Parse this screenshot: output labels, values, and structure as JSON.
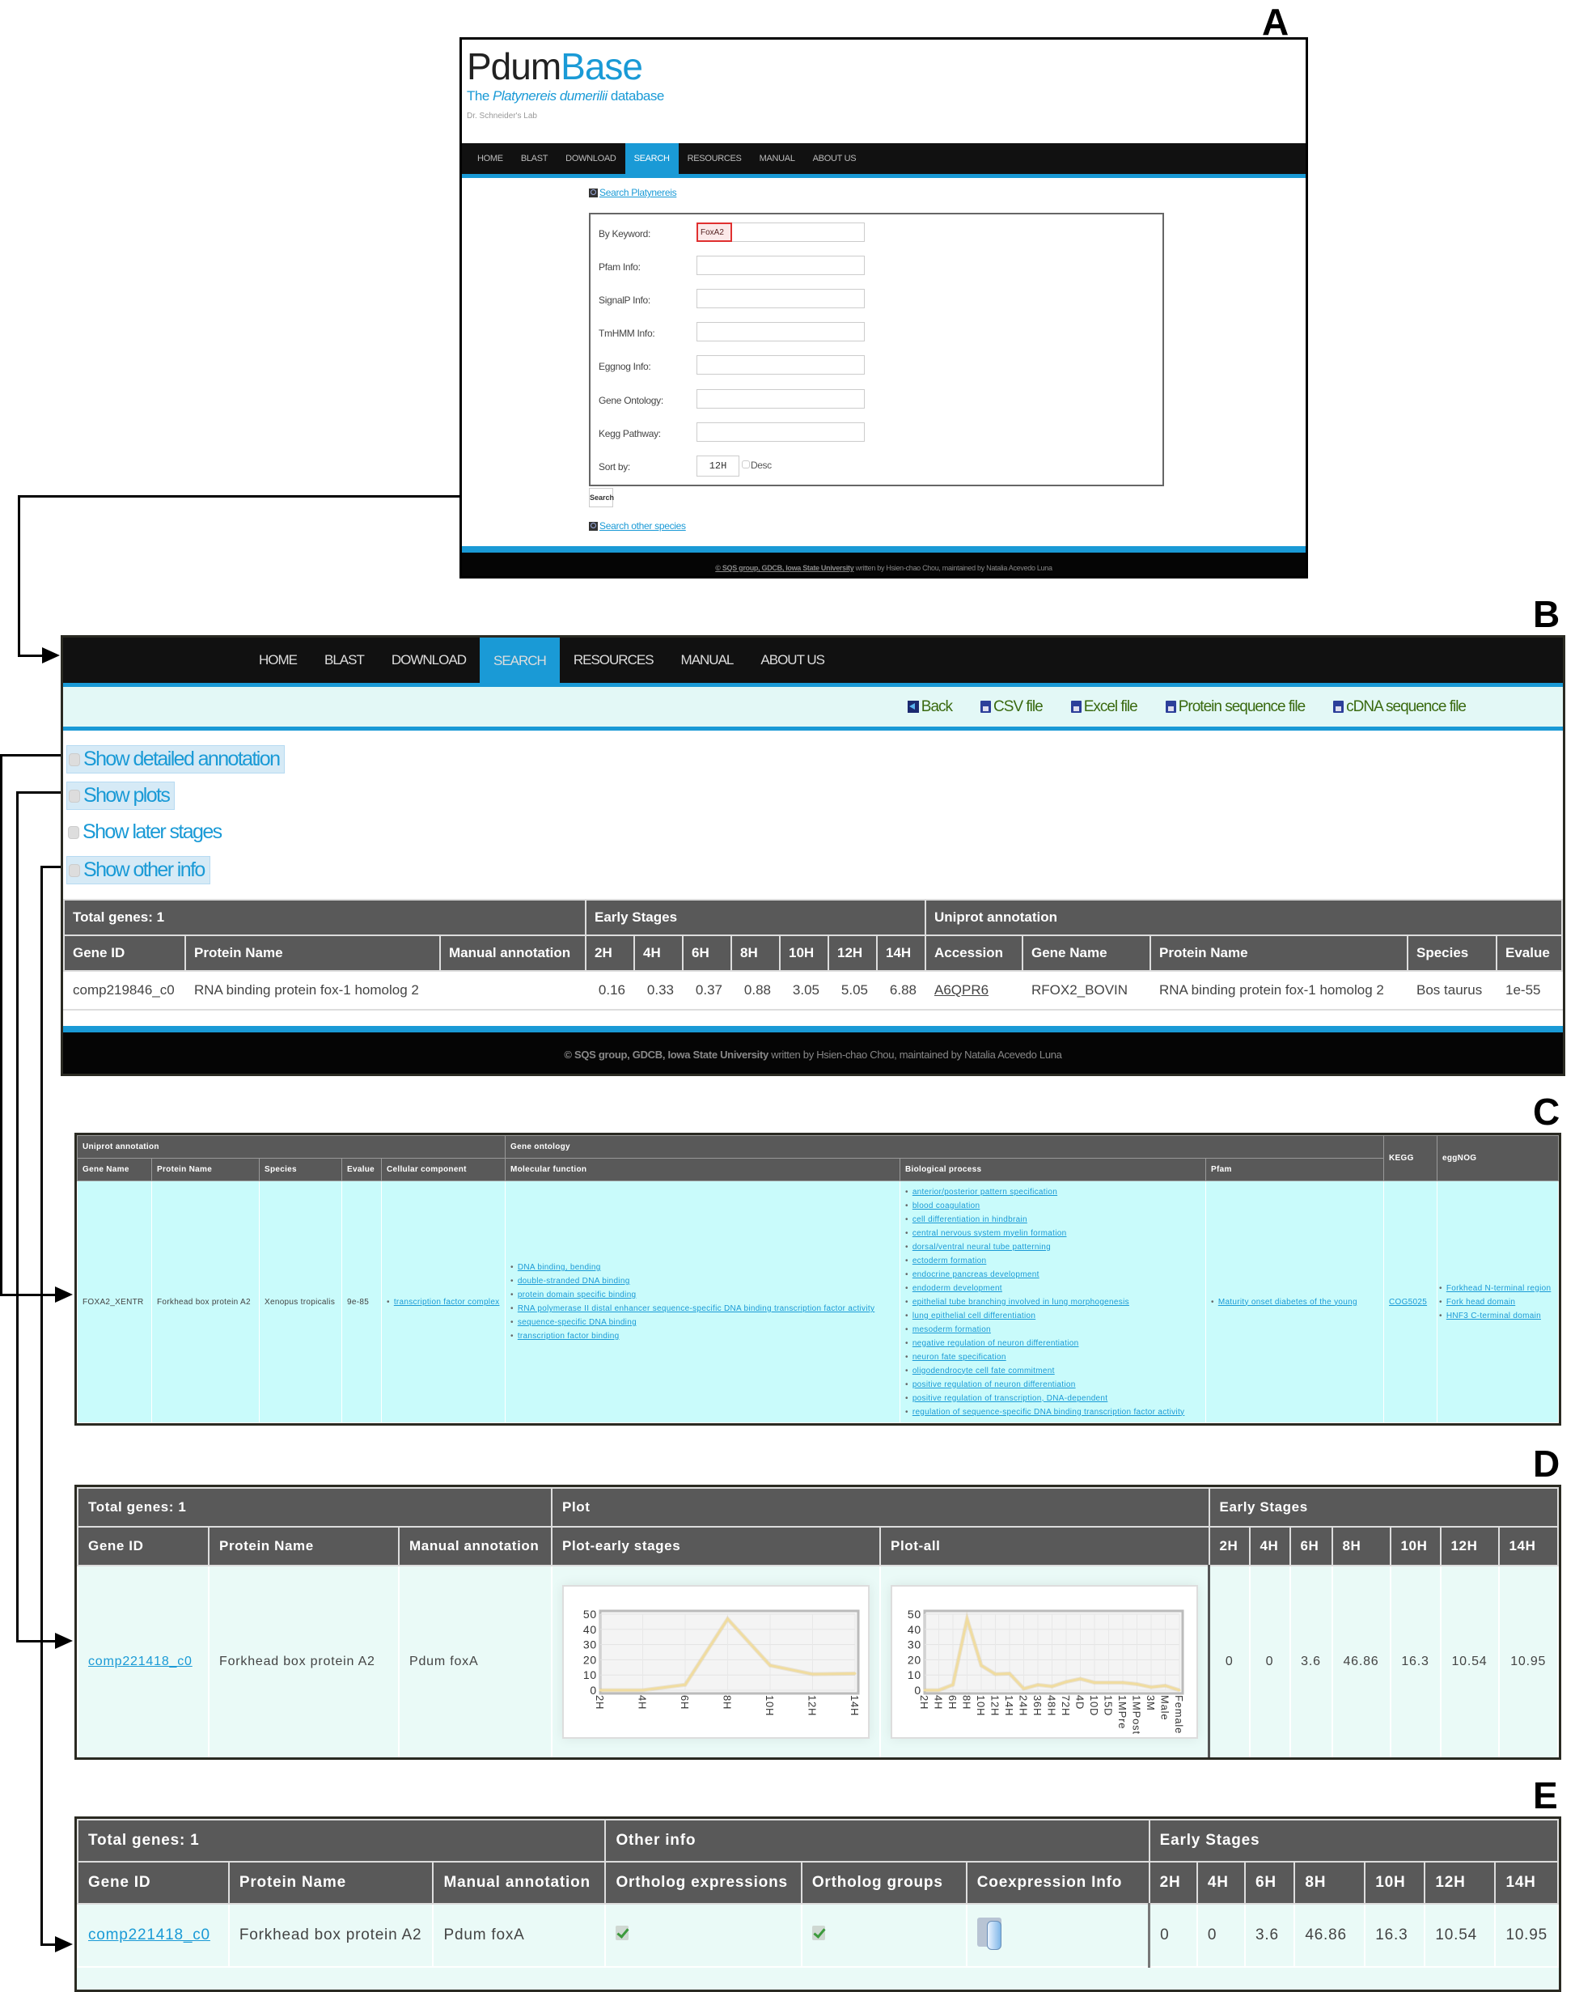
{
  "panel_labels": {
    "a": "A",
    "b": "B",
    "c": "C",
    "d": "D",
    "e": "E"
  },
  "site": {
    "brand_part1": "Pdum",
    "brand_part2": "Base",
    "tagline_pre": "The ",
    "tagline_species": "Platynereis dumerilii",
    "tagline_post": " database",
    "lab": "Dr. Schneider's Lab",
    "nav": [
      "HOME",
      "BLAST",
      "DOWNLOAD",
      "SEARCH",
      "RESOURCES",
      "MANUAL",
      "ABOUT US"
    ],
    "active_nav": "SEARCH",
    "footer_link": "© SQS group, GDCB, Iowa State University",
    "footer_text": " written by Hsien-chao Chou, maintained by Natalia Acevedo Luna"
  },
  "search_form": {
    "title_link": "Search Platynereis",
    "fields": [
      {
        "label": "By Keyword:",
        "value": "FoxA2"
      },
      {
        "label": "Pfam Info:",
        "value": ""
      },
      {
        "label": "SignalP Info:",
        "value": ""
      },
      {
        "label": "TmHMM Info:",
        "value": ""
      },
      {
        "label": "Eggnog Info:",
        "value": ""
      },
      {
        "label": "Gene Ontology:",
        "value": ""
      },
      {
        "label": "Kegg Pathway:",
        "value": ""
      }
    ],
    "sort_label": "Sort by:",
    "sort_value": "12H",
    "desc_label": "Desc",
    "desc_checked": false,
    "search_button": "Search",
    "other_link": "Search other species"
  },
  "results_page": {
    "downloads": [
      {
        "icon": "back-icon",
        "label": "Back"
      },
      {
        "icon": "disk-icon",
        "label": "CSV file"
      },
      {
        "icon": "disk-icon",
        "label": "Excel file"
      },
      {
        "icon": "disk-icon",
        "label": "Protein sequence file"
      },
      {
        "icon": "disk-icon",
        "label": "cDNA sequence file"
      }
    ],
    "toggles": [
      {
        "label": "Show detailed annotation",
        "highlighted": true
      },
      {
        "label": "Show plots",
        "highlighted": true
      },
      {
        "label": "Show later stages",
        "highlighted": false
      },
      {
        "label": "Show other info",
        "highlighted": true
      }
    ],
    "table": {
      "group_headers": [
        "Total genes: 1",
        "Early Stages",
        "Uniprot annotation"
      ],
      "columns": [
        "Gene ID",
        "Protein Name",
        "Manual annotation",
        "2H",
        "4H",
        "6H",
        "8H",
        "10H",
        "12H",
        "14H",
        "Accession",
        "Gene Name",
        "Protein Name",
        "Species",
        "Evalue"
      ],
      "row": {
        "gene_id": "comp219846_c0",
        "protein_name": "RNA binding protein fox-1 homolog 2",
        "manual_annotation": "",
        "stages": [
          "0.16",
          "0.33",
          "0.37",
          "0.88",
          "3.05",
          "5.05",
          "6.88"
        ],
        "accession": "A6QPR6",
        "gene_name": "RFOX2_BOVIN",
        "uniprot_protein_name": "RNA binding protein fox-1 homolog 2",
        "species": "Bos taurus",
        "evalue": "1e-55"
      }
    }
  },
  "detailed_annotation": {
    "group_headers": [
      "Uniprot annotation",
      "Gene ontology",
      "KEGG",
      "eggNOG"
    ],
    "columns": [
      "Gene Name",
      "Protein Name",
      "Species",
      "Evalue",
      "Cellular component",
      "Molecular function",
      "Biological process",
      "Pfam"
    ],
    "row": {
      "gene_name": "FOXA2_XENTR",
      "protein_name": "Forkhead box protein A2",
      "species": "Xenopus tropicalis",
      "evalue": "9e-85",
      "cellular_component": [
        "transcription factor complex"
      ],
      "molecular_function": [
        "DNA binding, bending",
        "double-stranded DNA binding",
        "protein domain specific binding",
        "RNA polymerase II distal enhancer sequence-specific DNA binding transcription factor activity",
        "sequence-specific DNA binding",
        "transcription factor binding"
      ],
      "biological_process": [
        "anterior/posterior pattern specification",
        "blood coagulation",
        "cell differentiation in hindbrain",
        "central nervous system myelin formation",
        "dorsal/ventral neural tube patterning",
        "ectoderm formation",
        "endocrine pancreas development",
        "endoderm development",
        "epithelial tube branching involved in lung morphogenesis",
        "lung epithelial cell differentiation",
        "mesoderm formation",
        "negative regulation of neuron differentiation",
        "neuron fate specification",
        "oligodendrocyte cell fate commitment",
        "positive regulation of neuron differentiation",
        "positive regulation of transcription, DNA-dependent",
        "regulation of sequence-specific DNA binding transcription factor activity"
      ],
      "pfam": [
        "Maturity onset diabetes of the young"
      ],
      "kegg": "COG5025",
      "eggnog": [
        "Forkhead N-terminal region",
        "Fork head domain",
        "HNF3 C-terminal domain"
      ]
    }
  },
  "plots_table": {
    "group_headers": [
      "Total genes: 1",
      "Plot",
      "Early Stages"
    ],
    "columns": [
      "Gene ID",
      "Protein Name",
      "Manual annotation",
      "Plot-early stages",
      "Plot-all",
      "2H",
      "4H",
      "6H",
      "8H",
      "10H",
      "12H",
      "14H"
    ],
    "row": {
      "gene_id": "comp221418_c0",
      "protein_name": "Forkhead box protein A2",
      "manual_annotation": "Pdum foxA",
      "stages": [
        "0",
        "0",
        "3.6",
        "46.86",
        "16.3",
        "10.54",
        "10.95"
      ]
    }
  },
  "other_info_table": {
    "group_headers": [
      "Total genes: 1",
      "Other info",
      "Early Stages"
    ],
    "columns": [
      "Gene ID",
      "Protein Name",
      "Manual annotation",
      "Ortholog expressions",
      "Ortholog groups",
      "Coexpression Info",
      "2H",
      "4H",
      "6H",
      "8H",
      "10H",
      "12H",
      "14H"
    ],
    "row": {
      "gene_id": "comp221418_c0",
      "protein_name": "Forkhead box protein A2",
      "manual_annotation": "Pdum foxA",
      "ortholog_expressions": "check-icon",
      "ortholog_groups": "check-icon",
      "coexpression_info": "database-icon",
      "stages": [
        "0",
        "0",
        "3.6",
        "46.86",
        "16.3",
        "10.54",
        "10.95"
      ]
    }
  },
  "chart_data": [
    {
      "type": "line",
      "title": "Plot-early stages",
      "categories": [
        "2H",
        "4H",
        "6H",
        "8H",
        "10H",
        "12H",
        "14H"
      ],
      "values": [
        0,
        0,
        3.6,
        46.86,
        16.3,
        10.54,
        10.95
      ],
      "yticks": [
        0,
        10,
        20,
        30,
        40,
        50
      ],
      "ylim": [
        0,
        50
      ],
      "grid": true,
      "line_color": "#f0dca0"
    },
    {
      "type": "line",
      "title": "Plot-all",
      "categories": [
        "2H",
        "4H",
        "6H",
        "8H",
        "10H",
        "12H",
        "14H",
        "24H",
        "36H",
        "48H",
        "72H",
        "4D",
        "10D",
        "15D",
        "1MPre",
        "1MPost",
        "3M",
        "Male",
        "Female"
      ],
      "values": [
        0,
        0,
        3.6,
        46.86,
        16.3,
        10.54,
        10.95,
        1,
        3.5,
        2.5,
        5.5,
        7.5,
        5,
        5,
        5,
        4,
        2,
        3,
        0
      ],
      "yticks": [
        0,
        10,
        20,
        30,
        40,
        50
      ],
      "ylim": [
        0,
        50
      ],
      "grid": true,
      "line_color": "#f0dca0"
    }
  ]
}
